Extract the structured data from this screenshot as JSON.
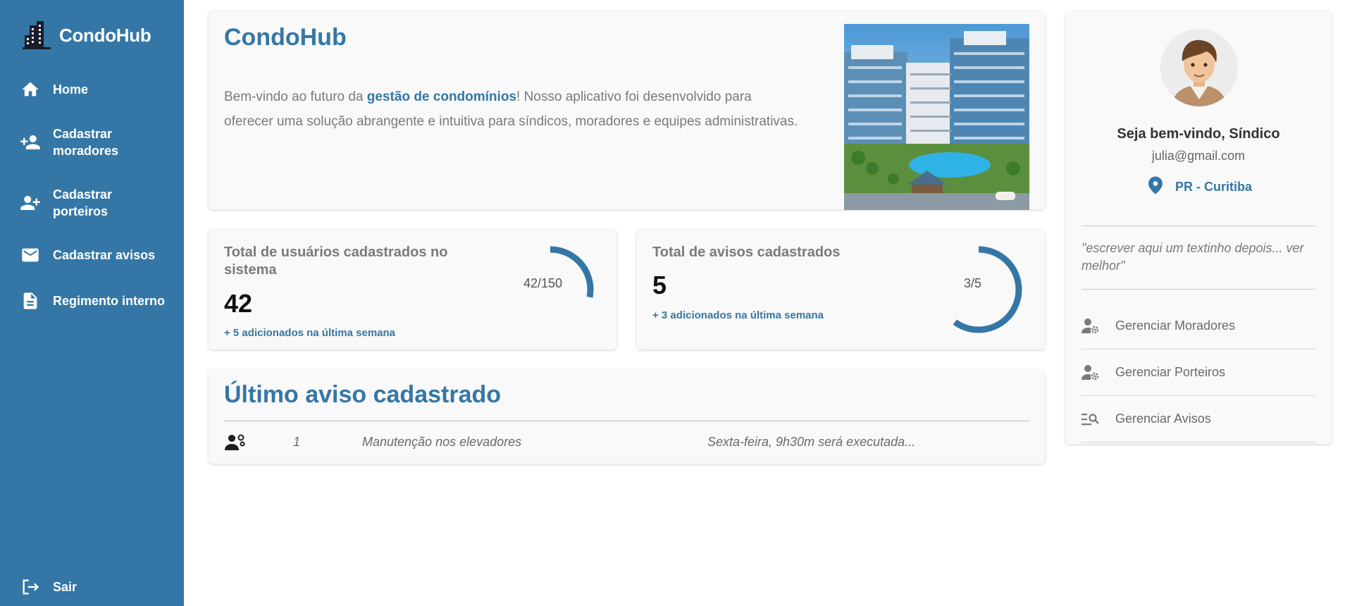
{
  "brand": {
    "name": "CondoHub"
  },
  "sidebar": {
    "items": [
      {
        "label": "Home",
        "icon": "home-icon"
      },
      {
        "label": "Cadastrar moradores",
        "icon": "person-add-icon"
      },
      {
        "label": "Cadastrar porteiros",
        "icon": "group-add-icon"
      },
      {
        "label": "Cadastrar avisos",
        "icon": "mail-icon"
      },
      {
        "label": "Regimento interno",
        "icon": "document-icon"
      }
    ],
    "logout": {
      "label": "Sair",
      "icon": "logout-icon"
    }
  },
  "hero": {
    "title": "CondoHub",
    "text_before": "Bem-vindo ao futuro da ",
    "highlight": "gestão de condomínios",
    "text_after": "! Nosso aplicativo foi desenvolvido para oferecer uma solução abrangente e intuitiva para síndicos, moradores e equipes administrativas."
  },
  "stats": {
    "users": {
      "title": "Total de usuários cadastrados no sistema",
      "value": "42",
      "sub": "+ 5 adicionados na última semana",
      "gauge_label": "42/150",
      "current": 42,
      "max": 150
    },
    "notices": {
      "title": "Total de avisos cadastrados",
      "value": "5",
      "sub": "+ 3 adicionados na última semana",
      "gauge_label": "3/5",
      "current": 3,
      "max": 5
    }
  },
  "latest_notice": {
    "title": "Último aviso cadastrado",
    "row": {
      "icon": "engineer-icon",
      "id": "1",
      "subject": "Manutenção nos elevadores",
      "description": "Sexta-feira, 9h30m será executada..."
    }
  },
  "profile": {
    "welcome": "Seja bem-vindo, Síndico",
    "email": "julia@gmail.com",
    "location": "PR - Curitiba",
    "quote": "\"escrever aqui um textinho depois... ver melhor\"",
    "actions": [
      {
        "label": "Gerenciar Moradores",
        "icon": "manage-user-icon"
      },
      {
        "label": "Gerenciar Porteiros",
        "icon": "manage-user-icon"
      },
      {
        "label": "Gerenciar Avisos",
        "icon": "manage-search-icon"
      }
    ]
  },
  "colors": {
    "primary": "#3477a6",
    "card_bg": "#f9f9f9"
  }
}
